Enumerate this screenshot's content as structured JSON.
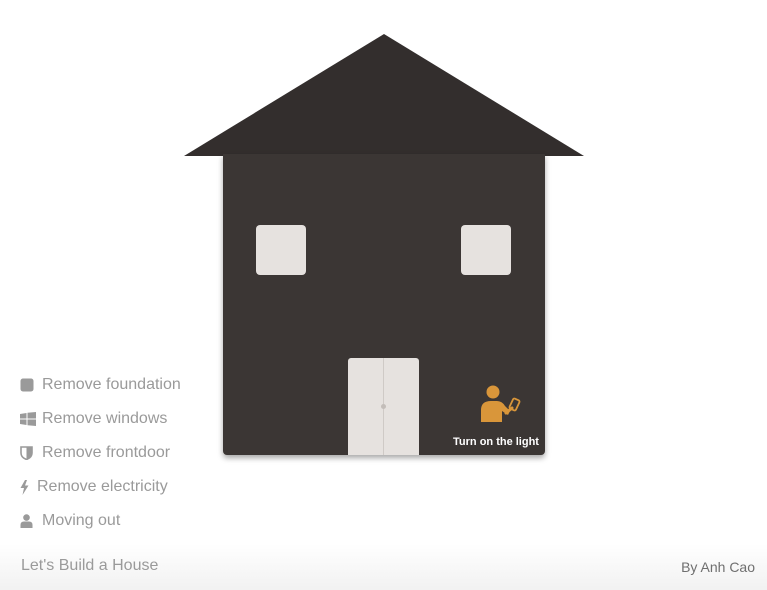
{
  "house": {
    "light_label": "Turn on the light",
    "colors": {
      "roof": "#332e2d",
      "body": "#3b3634",
      "window": "#e6e2df",
      "door": "#e6e2df",
      "accent": "#d9963a"
    },
    "icons": {
      "light_toggle": "person-with-phone-icon"
    }
  },
  "menu": {
    "items": [
      {
        "label": "Remove foundation",
        "icon": "square-icon"
      },
      {
        "label": "Remove windows",
        "icon": "windows-icon"
      },
      {
        "label": "Remove frontdoor",
        "icon": "shield-icon"
      },
      {
        "label": "Remove electricity",
        "icon": "bolt-icon"
      },
      {
        "label": "Moving out",
        "icon": "user-icon"
      }
    ]
  },
  "footer": {
    "title": "Let's Build a House",
    "author": "By Anh Cao"
  }
}
